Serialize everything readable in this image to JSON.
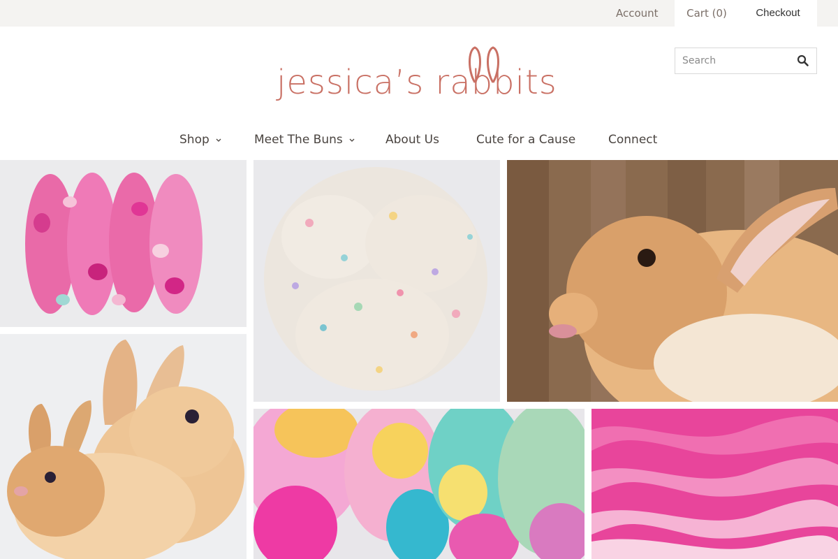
{
  "topbar": {
    "account_label": "Account",
    "cart_label": "Cart (0)",
    "checkout_label": "Checkout"
  },
  "logo": {
    "text": "jessica’s rabbits"
  },
  "search": {
    "placeholder": "Search",
    "value": "",
    "icon": "search-icon"
  },
  "nav": {
    "items": [
      {
        "label": "Shop",
        "has_dropdown": true
      },
      {
        "label": "Meet The Buns",
        "has_dropdown": true
      },
      {
        "label": "About Us",
        "has_dropdown": false
      },
      {
        "label": "Cute for a Cause",
        "has_dropdown": false
      },
      {
        "label": "Connect",
        "has_dropdown": false
      }
    ]
  },
  "colors": {
    "brand": "#c97064",
    "topbar_bg": "#f4f3f1",
    "nav_text": "#4a4440"
  },
  "tiles": [
    {
      "name": "tile-pink-yarn-skeins"
    },
    {
      "name": "tile-multicolor-yarn"
    },
    {
      "name": "tile-orange-rabbit-tongue"
    },
    {
      "name": "tile-baby-bunnies"
    },
    {
      "name": "tile-rainbow-fiber"
    },
    {
      "name": "tile-pink-knit-yarn"
    }
  ]
}
